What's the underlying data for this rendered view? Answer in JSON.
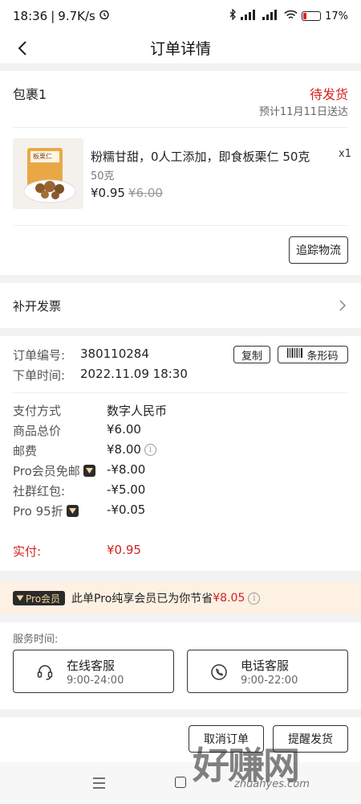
{
  "status_bar": {
    "time": "18:36",
    "speed": "9.7K/s",
    "battery_percent": "17%",
    "battery_level": 0.17,
    "battery_color": "#e02020"
  },
  "nav": {
    "title": "订单详情",
    "back_icon": "chevron-left-icon"
  },
  "package": {
    "name": "包裹1",
    "status": "待发货",
    "eta": "预计11月11日送达",
    "product": {
      "title": "粉糯甘甜，0人工添加，即食板栗仁 50克",
      "quantity": "x1",
      "spec": "50克",
      "price": "¥0.95",
      "original_price": "¥6.00",
      "package_text": "板栗仁"
    },
    "track_button": "追踪物流"
  },
  "invoice": {
    "label": "补开发票"
  },
  "order": {
    "number_label": "订单编号:",
    "number": "380110284",
    "copy_button": "复制",
    "barcode_button": "条形码",
    "time_label": "下单时间:",
    "time": "2022.11.09 18:30",
    "payment_rows": [
      {
        "label": "支付方式",
        "value": "数字人民币"
      },
      {
        "label": "商品总价",
        "value": "¥6.00"
      },
      {
        "label": "邮费",
        "value": "¥8.00"
      },
      {
        "label": "Pro会员免邮",
        "value": "-¥8.00"
      },
      {
        "label": "社群红包:",
        "value": "-¥5.00"
      },
      {
        "label": "Pro 95折",
        "value": "-¥0.05"
      }
    ],
    "paid_label": "实付:",
    "paid_value": "¥0.95"
  },
  "pro_banner": {
    "badge": "Pro会员",
    "text_prefix": "此单Pro纯享会员已为你节省",
    "saved_amount": "¥8.05"
  },
  "service": {
    "label": "服务时间:",
    "online": {
      "name": "在线客服",
      "hours": "9:00-24:00",
      "icon": "headset-icon"
    },
    "phone": {
      "name": "电话客服",
      "hours": "9:00-22:00",
      "icon": "phone-icon"
    }
  },
  "actions": {
    "cancel": "取消订单",
    "remind": "提醒发货"
  },
  "watermark": {
    "big": "好赚网",
    "small": "zhuanyes.com"
  },
  "colors": {
    "accent_red": "#d22222",
    "banner_bg": "#fdf1e3"
  }
}
